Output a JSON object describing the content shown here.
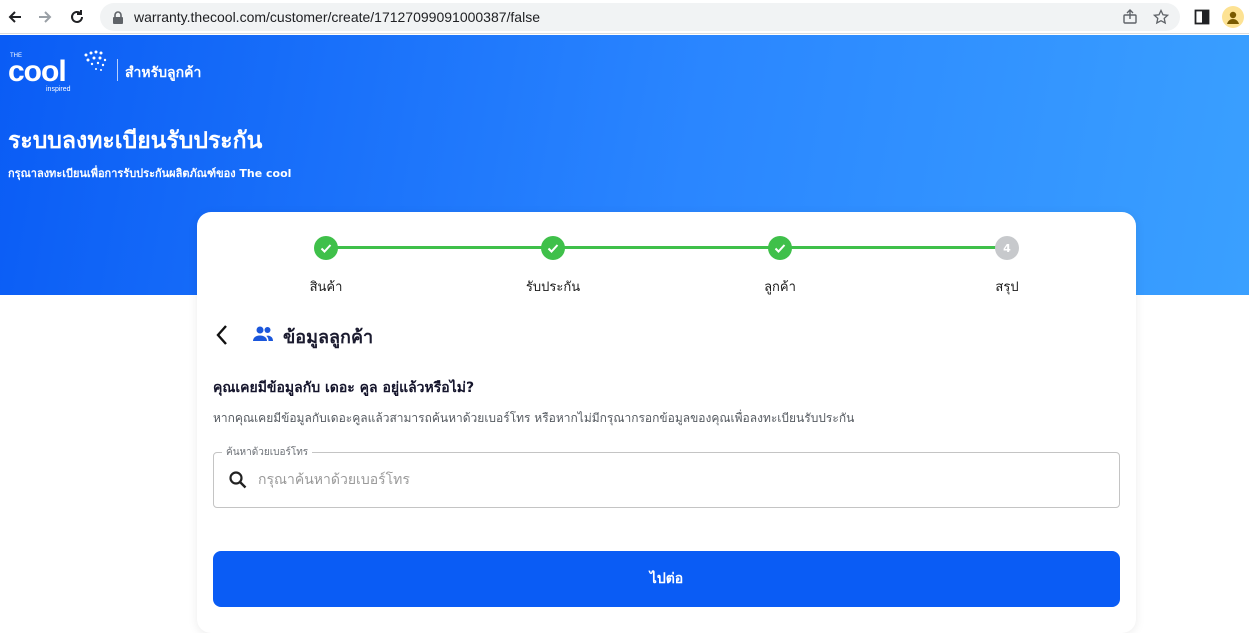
{
  "browser": {
    "url": "warranty.thecool.com/customer/create/17127099091000387/false",
    "icons": [
      "back-arrow-icon",
      "forward-arrow-icon",
      "reload-icon",
      "lock-icon",
      "share-icon",
      "star-icon",
      "sidepanel-icon",
      "profile-icon"
    ]
  },
  "header": {
    "logo_text": "THE COOL inspired",
    "subtitle": "สำหรับลูกค้า"
  },
  "hero": {
    "title": "ระบบลงทะเบียนรับประกัน",
    "subtitle": "กรุณาลงทะเบียนเพื่อการรับประกันผลิตภัณฑ์ของ The cool"
  },
  "stepper": {
    "steps": [
      {
        "label": "สินค้า",
        "status": "done"
      },
      {
        "label": "รับประกัน",
        "status": "done"
      },
      {
        "label": "ลูกค้า",
        "status": "done"
      },
      {
        "label": "สรุป",
        "status": "pending",
        "number": "4"
      }
    ]
  },
  "section": {
    "title": "ข้อมูลลูกค้า"
  },
  "form": {
    "question": "คุณเคยมีข้อมูลกับ เดอะ คูล อยู่แล้วหรือไม่?",
    "hint": "หากคุณเคยมีข้อมูลกับเดอะคูลแล้วสามารถค้นหาด้วยเบอร์โทร หรือหากไม่มีกรุณากรอกข้อมูลของคุณเพื่อลงทะเบียนรับประกัน",
    "search_label": "ค้นหาด้วยเบอร์โทร",
    "search_placeholder": "กรุณาค้นหาด้วยเบอร์โทร",
    "search_value": "",
    "submit_label": "ไปต่อ"
  },
  "colors": {
    "brand_blue": "#0a5cf5",
    "step_done": "#3fc04a",
    "step_pending": "#c7c9cc"
  }
}
